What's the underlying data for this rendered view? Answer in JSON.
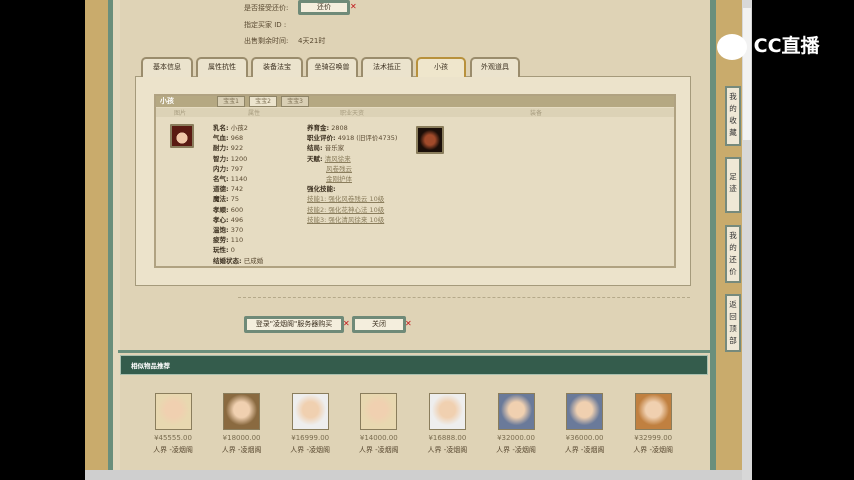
{
  "header": {
    "counter_offer_label": "是否接受还价:",
    "counter_offer_button": "还价",
    "buyer_id_label": "指定买家 ID :",
    "remaining_label": "出售剩余时间:",
    "remaining_value": "4天21时"
  },
  "tabs": [
    "基本信息",
    "属性抗性",
    "装备法宝",
    "坐骑召唤兽",
    "法术抵正",
    "小孩",
    "外观道具"
  ],
  "active_tab": "小孩",
  "child": {
    "title": "小孩",
    "subtabs": [
      "宝宝1",
      "宝宝2",
      "宝宝3"
    ],
    "active_subtab": "宝宝2",
    "columns": [
      "图片",
      "属性",
      "职业天资",
      "装备"
    ],
    "attributes": [
      [
        "乳名:",
        "小孩2"
      ],
      [
        "气血:",
        "968"
      ],
      [
        "耐力:",
        "922"
      ],
      [
        "智力:",
        "1200"
      ],
      [
        "内力:",
        "797"
      ],
      [
        "名气:",
        "1140"
      ],
      [
        "道德:",
        "742"
      ],
      [
        "魔法:",
        "75"
      ],
      [
        "孝顺:",
        "600"
      ],
      [
        "孝心:",
        "496"
      ],
      [
        "温饱:",
        "370"
      ],
      [
        "疲劳:",
        "110"
      ],
      [
        "玩性:",
        "0"
      ],
      [
        "结婚状态:",
        "已成婚"
      ]
    ],
    "career": {
      "fund_label": "养育金:",
      "fund": "2808",
      "eval_label": "职业评价:",
      "eval": "4918 (旧评价4735)",
      "ending_label": "结局:",
      "ending": "音乐家",
      "talent_label": "天赋:",
      "talents": [
        "清风徐来",
        "风卷残云",
        "金刚护体"
      ],
      "skills_label": "强化技能:",
      "skills": [
        "技能1: 强化风卷残云 10级",
        "技能2: 强化花神心法 10级",
        "技能3: 强化清风徐来 10级"
      ]
    }
  },
  "actions": {
    "buy": "登录\"凌烟阁\"服务器购买",
    "close": "关闭"
  },
  "recommend": {
    "title": "相似物品推荐",
    "items": [
      {
        "price": "¥45555.00",
        "server": "人界 -凌烟阁"
      },
      {
        "price": "¥18000.00",
        "server": "人界 -凌烟阁"
      },
      {
        "price": "¥16999.00",
        "server": "人界 -凌烟阁"
      },
      {
        "price": "¥14000.00",
        "server": "人界 -凌烟阁"
      },
      {
        "price": "¥16888.00",
        "server": "人界 -凌烟阁"
      },
      {
        "price": "¥32000.00",
        "server": "人界 -凌烟阁"
      },
      {
        "price": "¥36000.00",
        "server": "人界 -凌烟阁"
      },
      {
        "price": "¥32999.00",
        "server": "人界 -凌烟阁"
      }
    ]
  },
  "sidebar": [
    "我的收藏",
    "足迹",
    "我的还价",
    "返回顶部"
  ],
  "watermark": "CC直播",
  "colors": {
    "green": "#345c4c",
    "frame": "#c9ab6c",
    "bg": "#dfd3b6"
  }
}
